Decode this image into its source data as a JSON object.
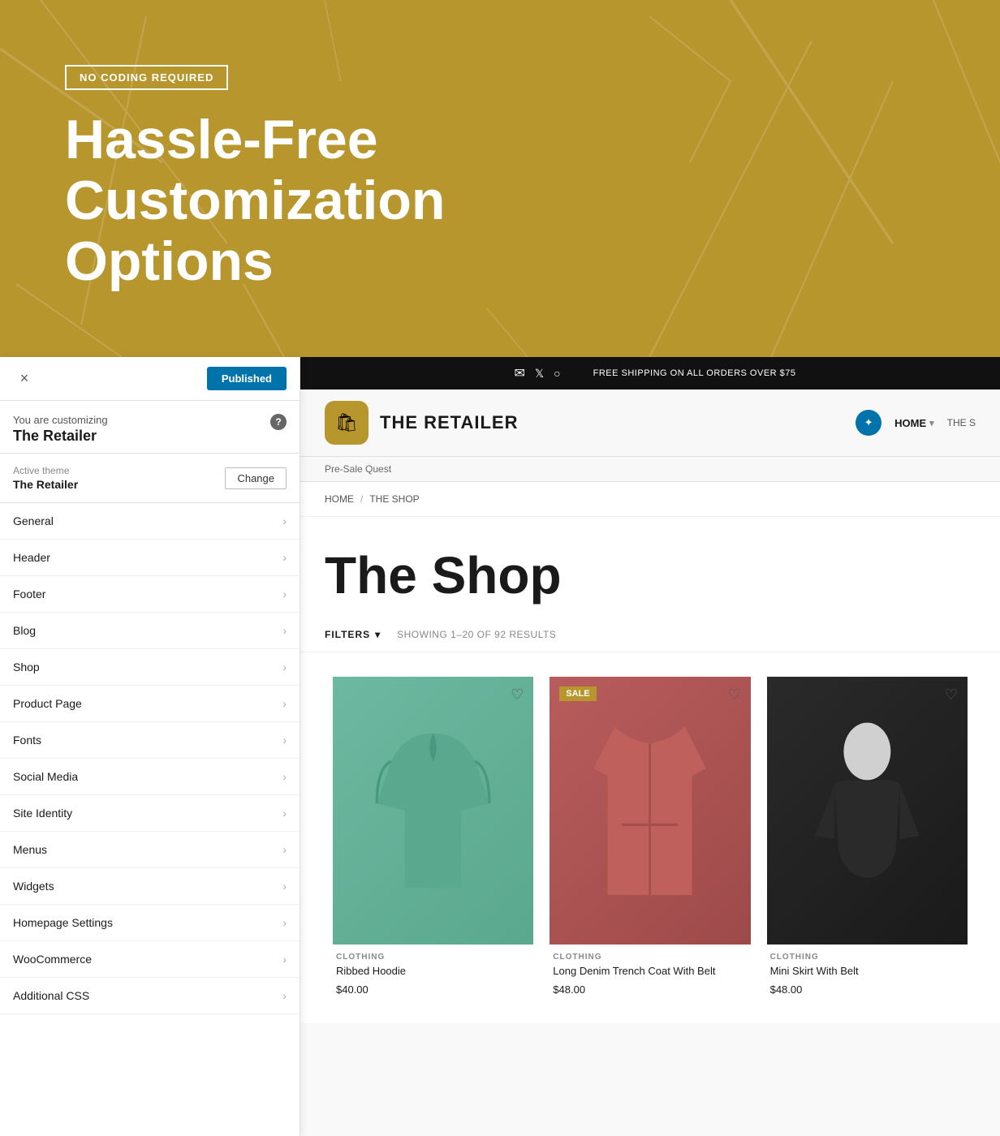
{
  "hero": {
    "badge": "NO CODING REQUIRED",
    "title_line1": "Hassle-Free",
    "title_line2": "Customization Options"
  },
  "customizer": {
    "close_label": "×",
    "published_label": "Published",
    "info_label": "You are customizing",
    "theme_name": "The Retailer",
    "help_icon": "?",
    "active_theme_label": "Active theme",
    "active_theme_name": "The Retailer",
    "change_label": "Change",
    "menu_items": [
      {
        "label": "General"
      },
      {
        "label": "Header"
      },
      {
        "label": "Footer"
      },
      {
        "label": "Blog"
      },
      {
        "label": "Shop"
      },
      {
        "label": "Product Page"
      },
      {
        "label": "Fonts"
      },
      {
        "label": "Social Media"
      },
      {
        "label": "Site Identity"
      },
      {
        "label": "Menus"
      },
      {
        "label": "Widgets"
      },
      {
        "label": "Homepage Settings"
      },
      {
        "label": "WooCommerce"
      },
      {
        "label": "Additional CSS"
      }
    ]
  },
  "preview": {
    "topbar_text": "FREE SHIPPING ON ALL ORDERS OVER $75",
    "store_name": "THE RETAILER",
    "nav_home": "HOME",
    "nav_extra": "THE S",
    "nav_presale": "Pre-Sale Quest",
    "breadcrumb_home": "HOME",
    "breadcrumb_sep": "/",
    "breadcrumb_current": "THE SHOP",
    "shop_title": "The Shop",
    "filters_label": "FILTERS",
    "results_text": "SHOWING 1–20 OF 92 RESULTS",
    "products": [
      {
        "category": "CLOTHING",
        "name": "Ribbed Hoodie",
        "price": "$40.00",
        "sale": false,
        "color_class": "product-img-hoodie"
      },
      {
        "category": "CLOTHING",
        "name": "Long Denim Trench Coat With Belt",
        "price": "$48.00",
        "sale": true,
        "color_class": "product-img-coat"
      },
      {
        "category": "CLOTHING",
        "name": "Mini Skirt With Belt",
        "price": "$48.00",
        "sale": false,
        "color_class": "product-img-skirt"
      }
    ]
  },
  "colors": {
    "accent": "#b8962e",
    "nav_blue": "#0073aa",
    "dark": "#111111"
  }
}
